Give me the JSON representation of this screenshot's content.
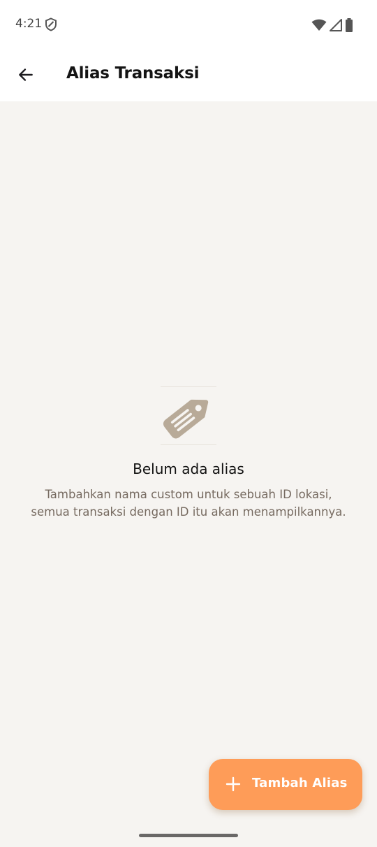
{
  "status_bar": {
    "time": "4:21",
    "icons": [
      "shield-icon",
      "wifi-icon",
      "signal-icon",
      "battery-icon"
    ]
  },
  "app_bar": {
    "back_icon": "arrow-back-icon",
    "title": "Alias Transaksi"
  },
  "empty_state": {
    "icon": "tag-icon",
    "title": "Belum ada alias",
    "description": "Tambahkan nama custom untuk sebuah ID lokasi, semua transaksi dengan ID itu akan menampilkannya."
  },
  "fab": {
    "icon": "plus-icon",
    "label": "Tambah Alias"
  },
  "colors": {
    "background": "#f6f4f1",
    "accent": "#fe9c58",
    "tag_icon": "#b8aa98",
    "description_text": "#766a60"
  }
}
